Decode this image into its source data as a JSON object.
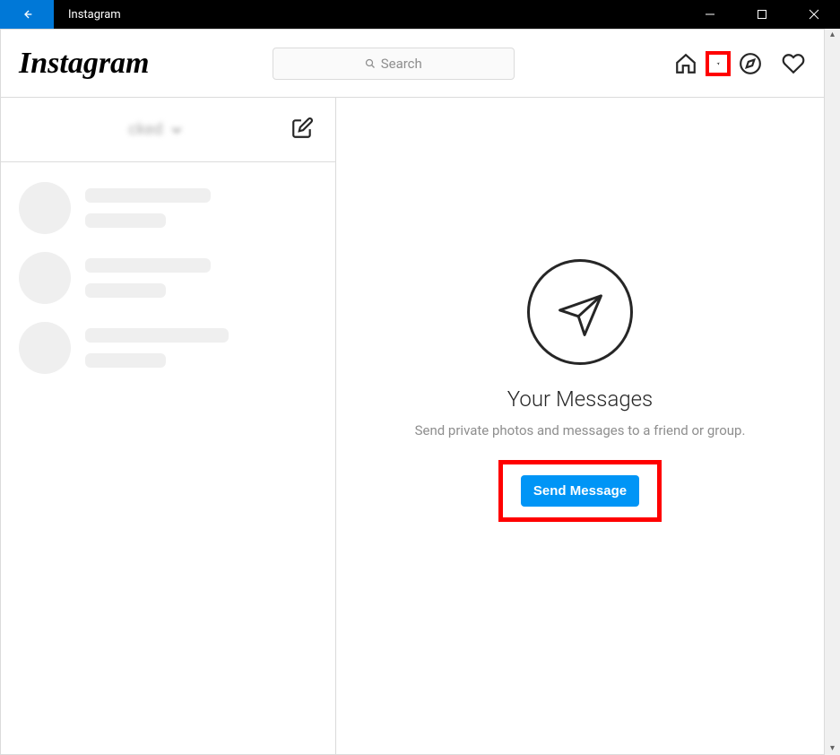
{
  "window": {
    "title": "Instagram"
  },
  "brand": {
    "logo_text": "Instagram"
  },
  "search": {
    "placeholder": "Search"
  },
  "sidebar": {
    "username_partial": "cked"
  },
  "pane": {
    "heading": "Your Messages",
    "subtext": "Send private photos and messages to a friend or group.",
    "button_label": "Send Message"
  }
}
